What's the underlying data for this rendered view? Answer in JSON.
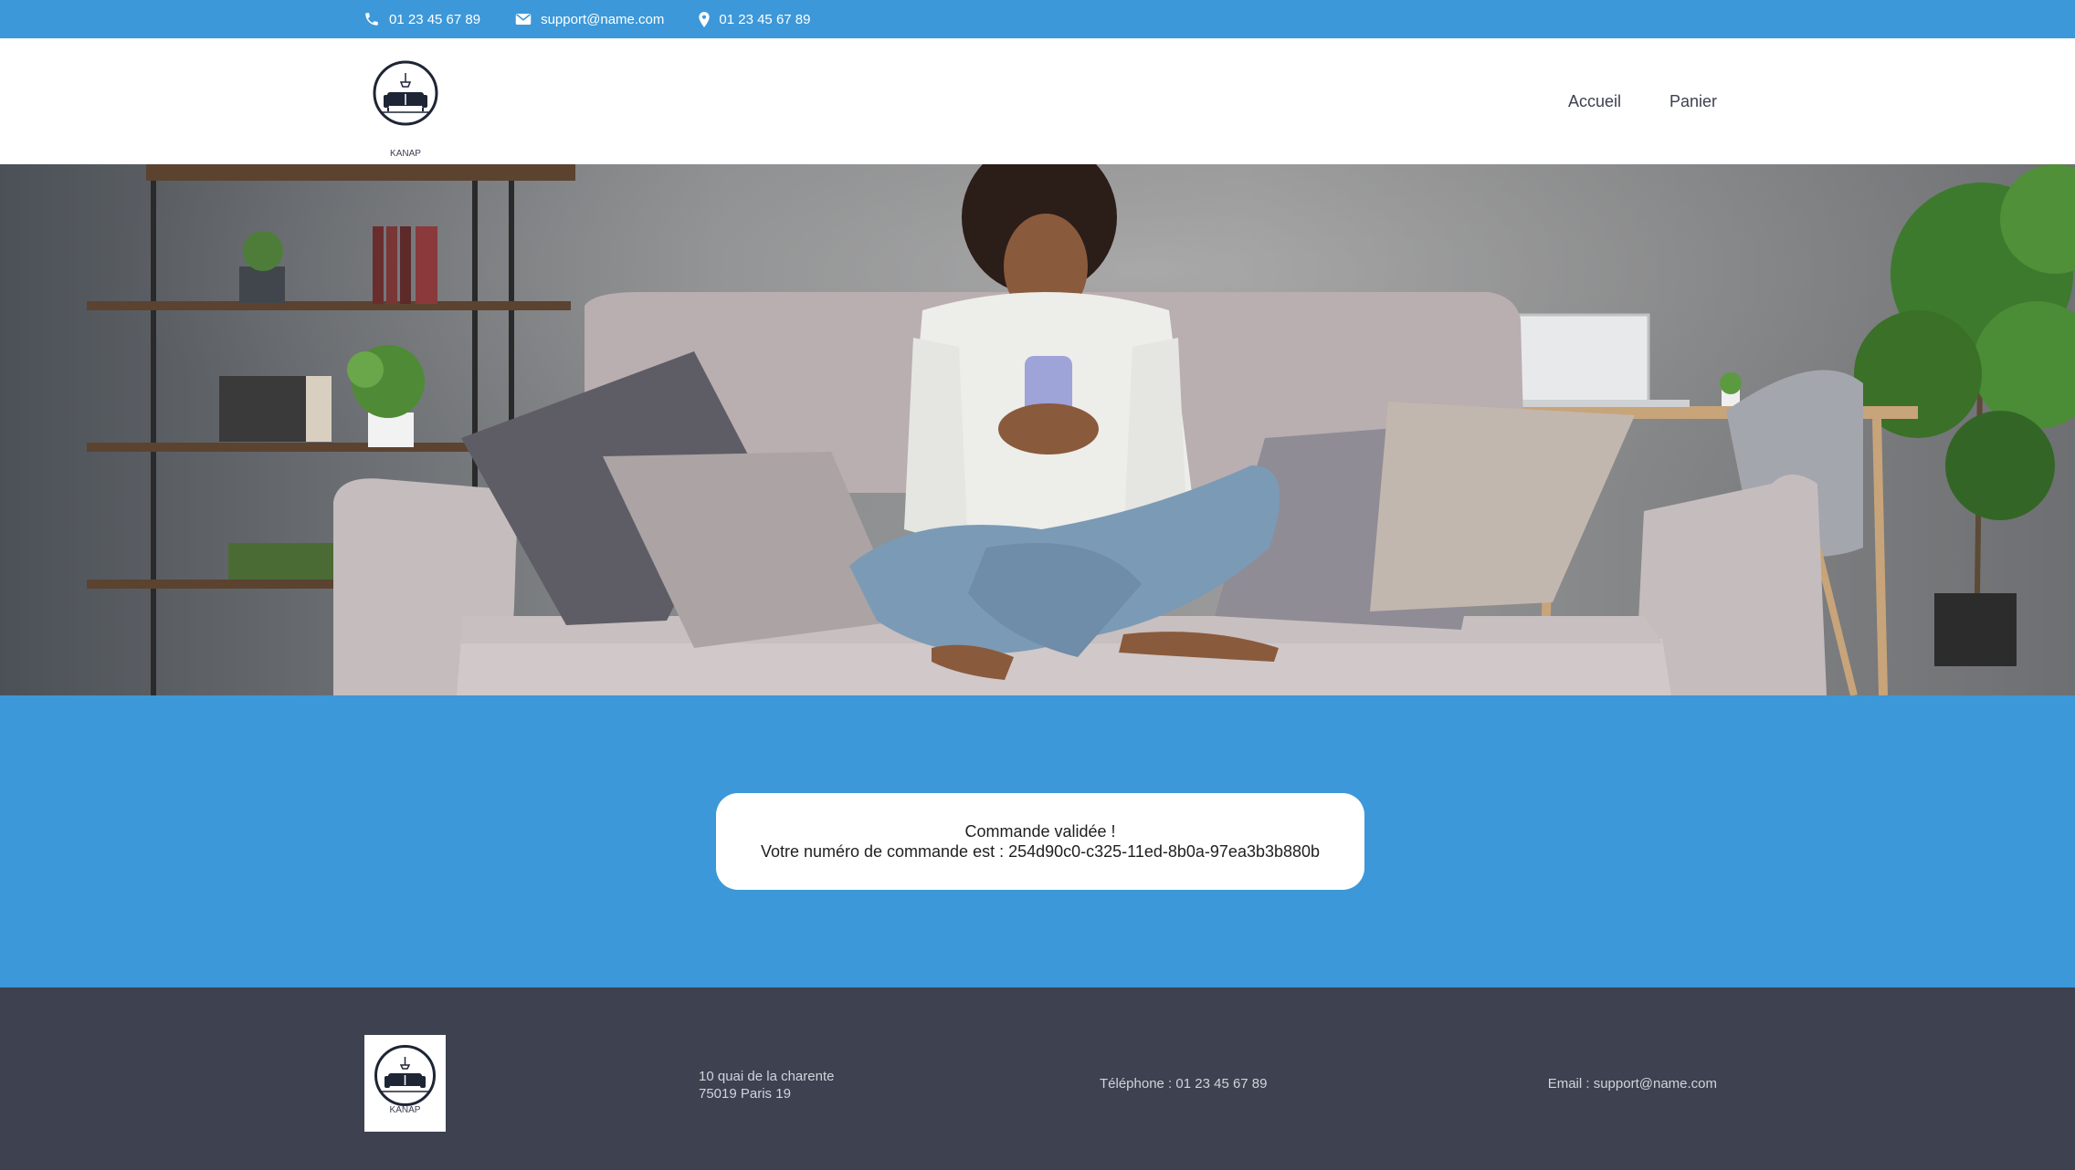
{
  "topbar": {
    "phone": "01 23 45 67 89",
    "email": "support@name.com",
    "location": "01 23 45 67 89",
    "icons": {
      "phone": "phone-icon",
      "email": "envelope-icon",
      "location": "map-pin-icon"
    }
  },
  "header": {
    "logo_text": "KANAP",
    "nav": {
      "home": "Accueil",
      "cart": "Panier"
    }
  },
  "confirmation": {
    "title": "Commande validée !",
    "order_line": "Votre numéro de commande est : 254d90c0-c325-11ed-8b0a-97ea3b3b880b"
  },
  "footer": {
    "logo_text": "KANAP",
    "address_line1": "10 quai de la charente",
    "address_line2": "75019 Paris 19",
    "phone": "Téléphone : 01 23 45 67 89",
    "email": "Email : support@name.com"
  },
  "colors": {
    "primary_blue": "#3c98d9",
    "footer_dark": "#3d4150",
    "white": "#ffffff"
  }
}
